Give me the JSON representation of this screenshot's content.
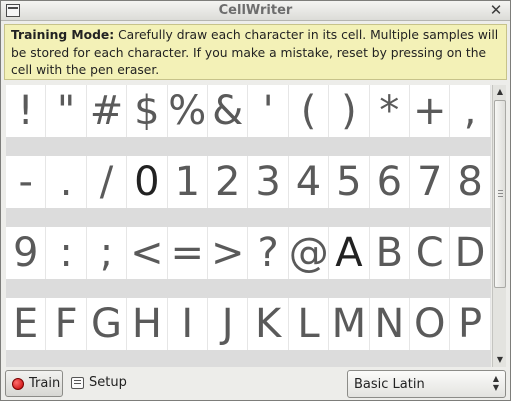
{
  "window": {
    "title": "CellWriter"
  },
  "banner": {
    "label": "Training Mode:",
    "text": " Carefully draw each character in its cell. Multiple samples will be stored for each character. If you make a mistake, reset by pressing on the cell with the pen eraser."
  },
  "grid": {
    "rows": [
      [
        "!",
        "\"",
        "#",
        "$",
        "%",
        "&",
        "'",
        "(",
        ")",
        "*",
        "+",
        ","
      ],
      [
        "-",
        ".",
        "/",
        "0",
        "1",
        "2",
        "3",
        "4",
        "5",
        "6",
        "7",
        "8"
      ],
      [
        "9",
        ":",
        ";",
        "<",
        "=",
        ">",
        "?",
        "@",
        "A",
        "B",
        "C",
        "D"
      ],
      [
        "E",
        "F",
        "G",
        "H",
        "I",
        "J",
        "K",
        "L",
        "M",
        "N",
        "O",
        "P"
      ]
    ],
    "trained": [
      "0",
      "A"
    ]
  },
  "toolbar": {
    "train_label": "Train",
    "setup_label": "Setup",
    "block_label": "Basic Latin"
  },
  "colors": {
    "banner_bg": "#f3f1b7",
    "record": "#e00000"
  }
}
